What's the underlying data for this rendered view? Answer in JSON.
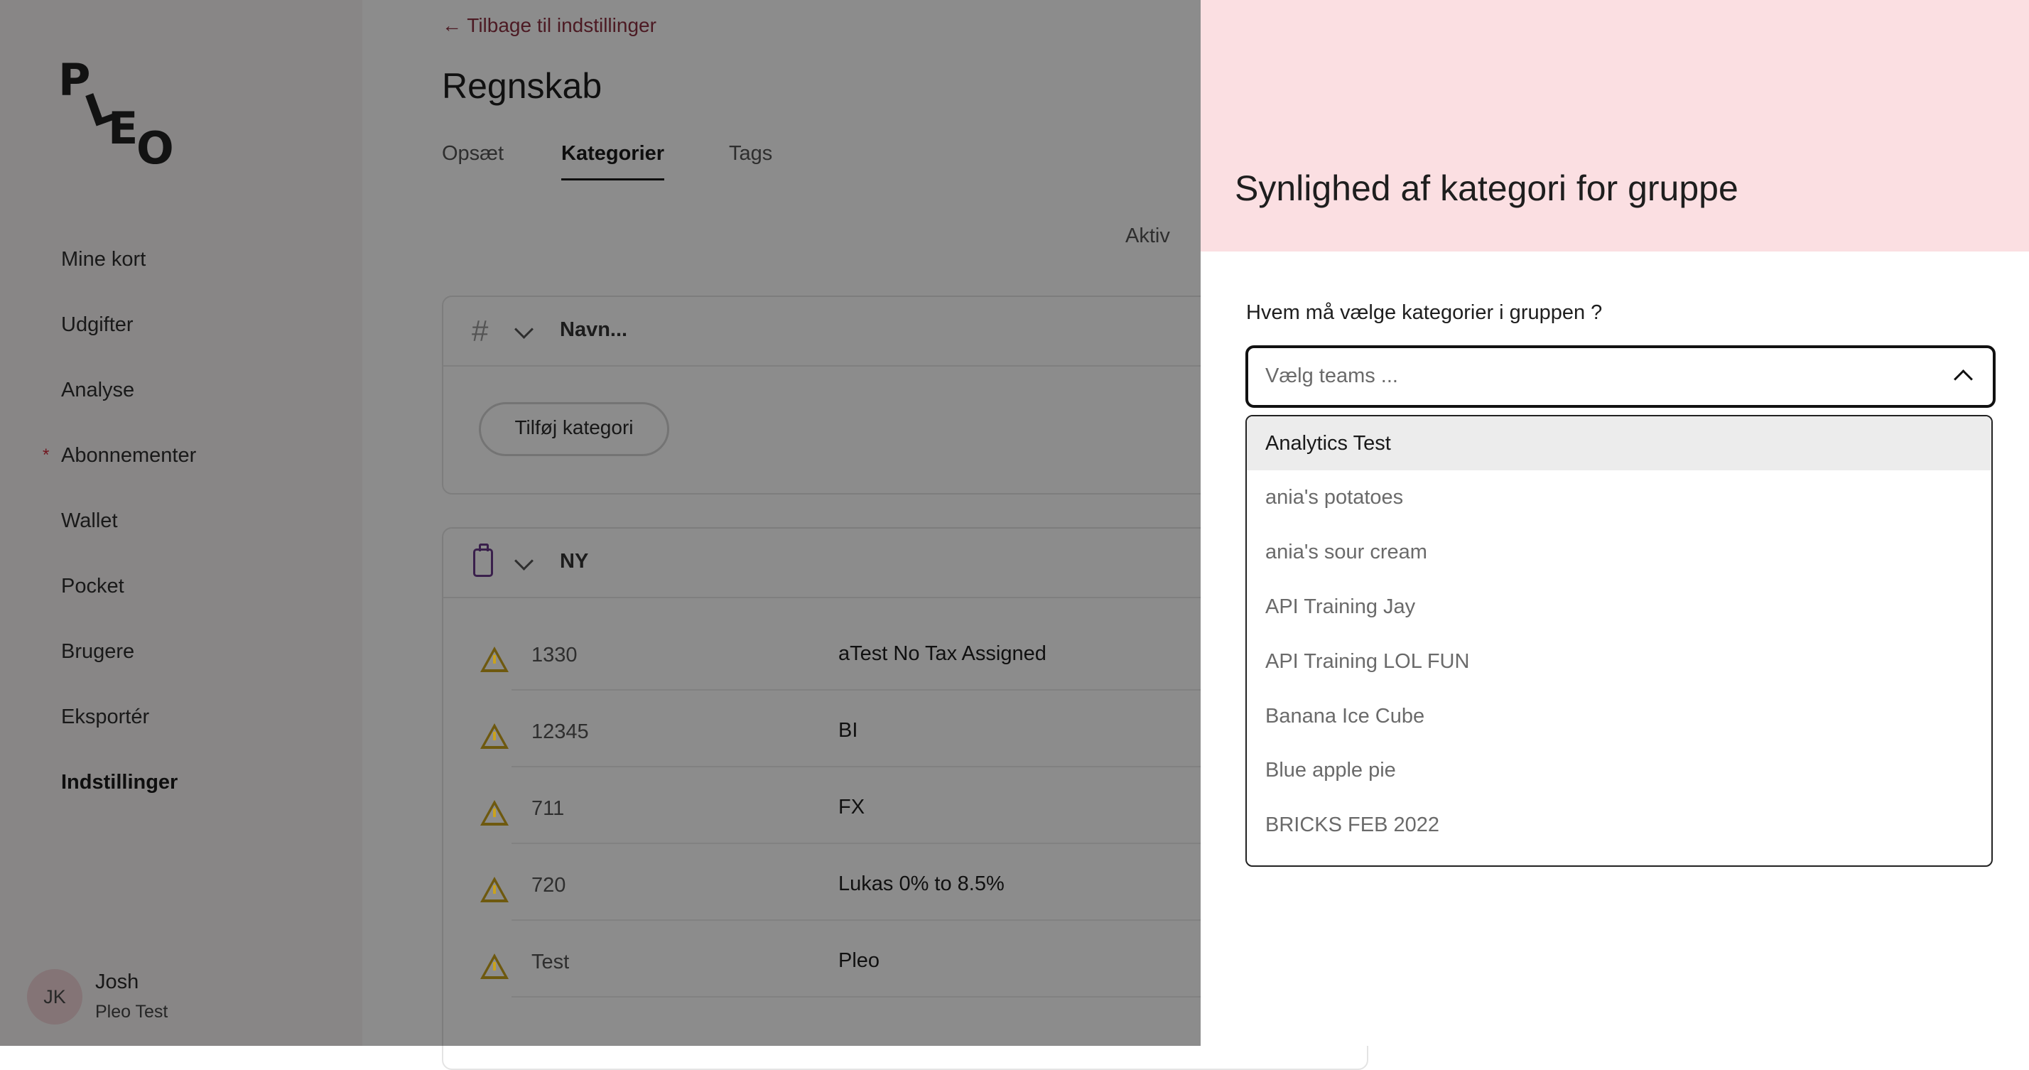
{
  "sidebar": {
    "logo": "PLEO",
    "items": [
      {
        "label": "Mine kort",
        "active": false,
        "dot": false
      },
      {
        "label": "Udgifter",
        "active": false,
        "dot": false
      },
      {
        "label": "Analyse",
        "active": false,
        "dot": false
      },
      {
        "label": "Abonnementer",
        "active": false,
        "dot": true
      },
      {
        "label": "Wallet",
        "active": false,
        "dot": false
      },
      {
        "label": "Pocket",
        "active": false,
        "dot": false
      },
      {
        "label": "Brugere",
        "active": false,
        "dot": false
      },
      {
        "label": "Eksportér",
        "active": false,
        "dot": false
      },
      {
        "label": "Indstillinger",
        "active": true,
        "dot": false
      }
    ],
    "user": {
      "initials": "JK",
      "name": "Josh",
      "company": "Pleo Test"
    }
  },
  "main": {
    "back_link": "← Tilbage til indstillinger",
    "title": "Regnskab",
    "tabs": [
      {
        "label": "Opsæt"
      },
      {
        "label": "Kategorier"
      },
      {
        "label": "Tags"
      }
    ],
    "filter_label": "Aktiv",
    "card1": {
      "header": "Navn...",
      "add_button": "Tilføj kategori"
    },
    "card2": {
      "header": "NY",
      "rows": [
        {
          "code": "1330",
          "name": "aTest No Tax Assigned"
        },
        {
          "code": "12345",
          "name": "BI"
        },
        {
          "code": "711",
          "name": "FX"
        },
        {
          "code": "720",
          "name": "Lukas 0% to 8.5%"
        },
        {
          "code": "Test",
          "name": "Pleo"
        }
      ]
    }
  },
  "drawer": {
    "title": "Synlighed af kategori for gruppe",
    "field_label": "Hvem må vælge kategorier i gruppen ?",
    "placeholder": "Vælg teams ...",
    "options": [
      "Analytics Test",
      "ania's potatoes",
      "ania's sour cream",
      "API Training Jay",
      "API Training LOL FUN",
      "Banana Ice Cube",
      "Blue apple pie",
      "BRICKS FEB 2022"
    ]
  },
  "colors": {
    "drawer_header": "#fbdfe2",
    "accent_link": "#8a3040",
    "warning": "#c9a21d",
    "overlay": "rgba(0,0,0,0.45)"
  }
}
